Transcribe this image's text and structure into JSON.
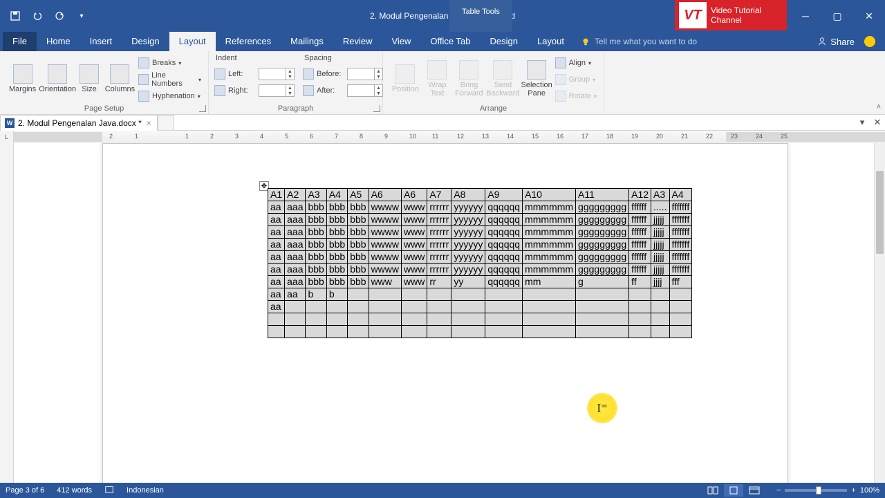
{
  "titlebar": {
    "title": "2. Modul Pengenalan Java.docx - Word",
    "context_tab": "Table Tools",
    "logo_text": "Video Tutorial\nChannel",
    "logo_badge": "VT"
  },
  "ribbon_tabs": {
    "file": "File",
    "home": "Home",
    "insert": "Insert",
    "design": "Design",
    "layout": "Layout",
    "references": "References",
    "mailings": "Mailings",
    "review": "Review",
    "view": "View",
    "office_tab": "Office Tab",
    "table_design": "Design",
    "table_layout": "Layout",
    "tell_me": "Tell me what you want to do",
    "share": "Share"
  },
  "ribbon": {
    "page_setup": {
      "margins": "Margins",
      "orientation": "Orientation",
      "size": "Size",
      "columns": "Columns",
      "breaks": "Breaks",
      "line_numbers": "Line Numbers",
      "hyphenation": "Hyphenation",
      "group": "Page Setup"
    },
    "paragraph": {
      "indent": "Indent",
      "left": "Left:",
      "right": "Right:",
      "spacing": "Spacing",
      "before": "Before:",
      "after": "After:",
      "group": "Paragraph"
    },
    "arrange": {
      "position": "Position",
      "wrap": "Wrap\nText",
      "bring": "Bring\nForward",
      "send": "Send\nBackward",
      "selection": "Selection\nPane",
      "align": "Align",
      "group_btn": "Group",
      "rotate": "Rotate",
      "group": "Arrange"
    }
  },
  "doc_tab": {
    "name": "2. Modul Pengenalan Java.docx *"
  },
  "table": {
    "headers": [
      "A1",
      "A2",
      "A3",
      "A4",
      "A5",
      "A6",
      "A6",
      "A7",
      "A8",
      "A9",
      "A10",
      "A11",
      "A12",
      "A3",
      "A4"
    ],
    "rows": [
      [
        "aa",
        "aaa",
        "bbb",
        "bbb",
        "bbb",
        "wwww",
        "www",
        "rrrrrr",
        "yyyyyy",
        "qqqqqq",
        "mmmmmm",
        "ggggggggg",
        "ffffff",
        ".....",
        "fffffff"
      ],
      [
        "aa",
        "aaa",
        "bbb",
        "bbb",
        "bbb",
        "wwww",
        "www",
        "rrrrrr",
        "yyyyyy",
        "qqqqqq",
        "mmmmmm",
        "ggggggggg",
        "ffffff",
        "jjjjj",
        "fffffff"
      ],
      [
        "aa",
        "aaa",
        "bbb",
        "bbb",
        "bbb",
        "wwww",
        "www",
        "rrrrrr",
        "yyyyyy",
        "qqqqqq",
        "mmmmmm",
        "ggggggggg",
        "ffffff",
        "jjjjj",
        "fffffff"
      ],
      [
        "aa",
        "aaa",
        "bbb",
        "bbb",
        "bbb",
        "wwww",
        "www",
        "rrrrrr",
        "yyyyyy",
        "qqqqqq",
        "mmmmmm",
        "ggggggggg",
        "ffffff",
        "jjjjj",
        "fffffff"
      ],
      [
        "aa",
        "aaa",
        "bbb",
        "bbb",
        "bbb",
        "wwww",
        "www",
        "rrrrrr",
        "yyyyyy",
        "qqqqqq",
        "mmmmmm",
        "ggggggggg",
        "ffffff",
        "jjjjj",
        "fffffff"
      ],
      [
        "aa",
        "aaa",
        "bbb",
        "bbb",
        "bbb",
        "wwww",
        "www",
        "rrrrrr",
        "yyyyyy",
        "qqqqqq",
        "mmmmmm",
        "ggggggggg",
        "ffffff",
        "jjjjj",
        "fffffff"
      ],
      [
        "aa",
        "aaa",
        "bbb",
        "bbb",
        "bbb",
        "www",
        "www",
        "rr",
        "yy",
        "qqqqqq",
        "mm",
        "g",
        "ff",
        "jjjj",
        "fff"
      ],
      [
        "aa",
        "aa",
        "b",
        "b",
        "",
        "",
        "",
        "",
        "",
        "",
        "",
        "",
        "",
        "",
        ""
      ],
      [
        "aa",
        "",
        "",
        "",
        "",
        "",
        "",
        "",
        "",
        "",
        "",
        "",
        "",
        "",
        ""
      ]
    ]
  },
  "statusbar": {
    "page": "Page 3 of 6",
    "words": "412 words",
    "language": "Indonesian",
    "zoom": "100%"
  },
  "ruler_nums": [
    "2",
    "1",
    "1",
    "2",
    "3",
    "4",
    "5",
    "6",
    "7",
    "8",
    "9",
    "10",
    "11",
    "12",
    "13",
    "14",
    "15",
    "16",
    "17",
    "18",
    "19",
    "20",
    "21",
    "22",
    "23",
    "24",
    "25"
  ]
}
